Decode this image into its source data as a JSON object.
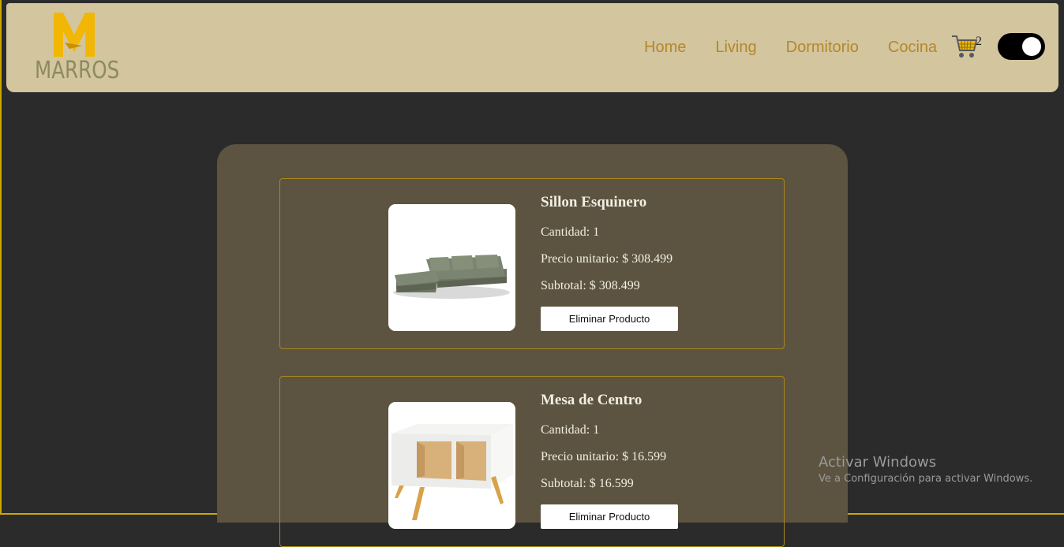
{
  "brand": {
    "logo_text": "MARROS",
    "logo_letter": "M"
  },
  "nav": {
    "links": [
      "Home",
      "Living",
      "Dormitorio",
      "Cocina"
    ],
    "cart_count": "2"
  },
  "cart_items": [
    {
      "name": "Sillon Esquinero",
      "quantity": "Cantidad: 1",
      "unit_price": "Precio unitario: $ 308.499",
      "subtotal": "Subtotal: $ 308.499",
      "delete_label": "Eliminar Producto"
    },
    {
      "name": "Mesa de Centro",
      "quantity": "Cantidad: 1",
      "unit_price": "Precio unitario: $ 16.599",
      "subtotal": "Subtotal: $ 16.599",
      "delete_label": "Eliminar Producto"
    }
  ],
  "watermark": {
    "title": "Activar Windows",
    "subtitle": "Ve a Configuración para activar Windows."
  },
  "colors": {
    "navbar_bg": "#d3c59e",
    "nav_link": "#b4872a",
    "page_bg": "#2b2b2b",
    "panel_bg": "#5c5440",
    "card_border": "#a8871d",
    "logo_accent": "#f2b705"
  }
}
